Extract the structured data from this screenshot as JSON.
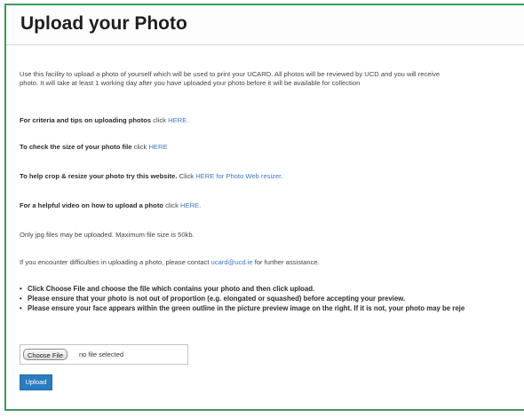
{
  "page": {
    "title": "Upload your Photo"
  },
  "intro": {
    "line1": "Use this facility to upload a photo of yourself which will be used to print your UCARD. All photos will be reviewed by UCD and you will receive",
    "line2": "photo. It will take at least 1 working day after you have uploaded your photo before it will be available for collection"
  },
  "criteria": {
    "text": "For criteria and tips on uploading photos",
    "click": "click",
    "link": "HERE."
  },
  "check_size": {
    "text": "To check the size of your photo file",
    "click": "click",
    "link": "HERE"
  },
  "crop": {
    "text": "To help crop & resize your photo try this website.",
    "click": "Click",
    "link": "HERE for Photo Web resizer."
  },
  "video": {
    "text": "For a helpful video on how to upload a photo",
    "click": "click",
    "link": "HERE."
  },
  "file_rules": "Only jpg files may be uploaded. Maximum file size is 50kb.",
  "contact": {
    "before": "If you encounter difficulties in uploading a photo, please contact",
    "email": "ucard@ucd.ie",
    "after": "for further assistance."
  },
  "bullets": [
    "Click Choose File and choose the file which contains your photo and then click upload.",
    "Please ensure that your photo is not out of proportion (e.g. elongated or squashed) before accepting your preview.",
    "Please ensure your face appears within the green outline in the picture preview image on the right. If it is not, your photo may be reje"
  ],
  "file_input": {
    "button_label": "Choose File",
    "status": "no file selected"
  },
  "upload_button": "Upload",
  "colors": {
    "link": "#3a78c9",
    "frame": "#3d9a5b",
    "button": "#2a7cc1"
  }
}
